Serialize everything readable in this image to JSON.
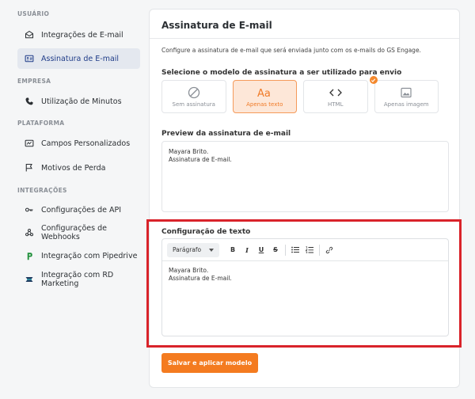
{
  "sidebar": {
    "sections": [
      {
        "title": "USUÁRIO",
        "items": [
          {
            "label": "Integrações de E-mail",
            "icon": "mail-icon"
          },
          {
            "label": "Assinatura de E-mail",
            "icon": "id-card-icon",
            "active": true
          }
        ]
      },
      {
        "title": "EMPRESA",
        "items": [
          {
            "label": "Utilização de Minutos",
            "icon": "phone-icon"
          }
        ]
      },
      {
        "title": "PLATAFORMA",
        "items": [
          {
            "label": "Campos Personalizados",
            "icon": "custom-field-icon"
          },
          {
            "label": "Motivos de Perda",
            "icon": "flag-icon"
          }
        ]
      },
      {
        "title": "INTEGRAÇÕES",
        "items": [
          {
            "label": "Configurações de API",
            "icon": "key-icon"
          },
          {
            "label": "Configurações de Webhooks",
            "icon": "webhook-icon"
          },
          {
            "label": "Integração com Pipedrive",
            "icon": "pipedrive-logo-icon"
          },
          {
            "label": "Integração com RD Marketing",
            "icon": "rd-logo-icon"
          }
        ]
      }
    ]
  },
  "main": {
    "title": "Assinatura de E-mail",
    "description": "Configure a assinatura de e-mail que será enviada junto com os e-mails do GS Engage.",
    "model_label": "Selecione o modelo de assinatura a ser utilizado para envio",
    "options": [
      {
        "label": "Sem assinatura",
        "icon": "no-signature-icon"
      },
      {
        "label": "Apenas texto",
        "icon": "text-icon",
        "selected": true
      },
      {
        "label": "HTML",
        "icon": "code-icon"
      },
      {
        "label": "Apenas imagem",
        "icon": "image-icon"
      }
    ],
    "preview_label": "Preview da assinatura de e-mail",
    "preview_lines": [
      "Mayara Brito.",
      "Assinatura de E-mail."
    ],
    "text_config_label": "Configuração de texto",
    "toolbar": {
      "paragraph": "Parágrafo",
      "bold": "B",
      "italic": "I",
      "underline": "U",
      "strike": "S"
    },
    "editor_lines": [
      "Mayara Brito.",
      "Assinatura de E-mail."
    ],
    "save_label": "Salvar e aplicar modelo"
  },
  "colors": {
    "accent": "#f47b20",
    "highlight": "#d9232a",
    "active_nav": "#1f3c88"
  }
}
